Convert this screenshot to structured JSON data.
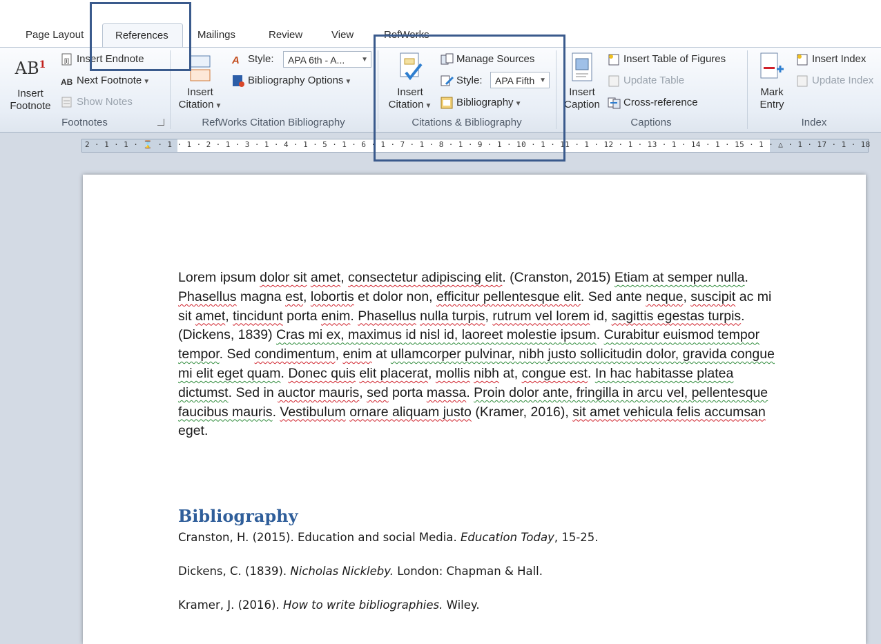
{
  "tabs": {
    "page_layout": "Page Layout",
    "references": "References",
    "mailings": "Mailings",
    "review": "Review",
    "view": "View",
    "refworks": "RefWorks"
  },
  "footnotes": {
    "ab_glyph": "AB",
    "ab_sup": "1",
    "insert_footnote_l1": "Insert",
    "insert_footnote_l2": "Footnote",
    "insert_endnote": "Insert Endnote",
    "next_footnote": "Next Footnote",
    "show_notes": "Show Notes",
    "group_label": "Footnotes"
  },
  "refworks": {
    "insert_citation_l1": "Insert",
    "insert_citation_l2": "Citation",
    "style_label": "Style:",
    "style_value": "APA 6th - A...",
    "bibliography_options": "Bibliography Options",
    "group_label": "RefWorks Citation  Bibliography"
  },
  "citations": {
    "insert_citation_l1": "Insert",
    "insert_citation_l2": "Citation",
    "manage_sources": "Manage Sources",
    "style_label": "Style:",
    "style_value": "APA Fifth",
    "bibliography": "Bibliography",
    "group_label": "Citations & Bibliography"
  },
  "captions": {
    "insert_caption_l1": "Insert",
    "insert_caption_l2": "Caption",
    "insert_table_of_figures": "Insert Table of Figures",
    "update_table": "Update Table",
    "cross_reference": "Cross-reference",
    "group_label": "Captions"
  },
  "index": {
    "mark_entry_l1": "Mark",
    "mark_entry_l2": "Entry",
    "insert_index": "Insert Index",
    "update_index": "Update Index",
    "group_label": "Index"
  },
  "ruler": {
    "scale": "2 · 1 · 1 · ⌛ · 1 · 1 · 2 · 1 · 3 · 1 · 4 · 1 · 5 · 1 · 6 · 1 · 7 · 1 · 8 · 1 · 9 · 1 · 10 · 1 · 11 · 1 · 12 · 1 · 13 · 1 · 14 · 1 · 15 · 1 · △ · 1 · 17 · 1 · 18"
  },
  "document": {
    "paragraph": [
      {
        "t": "Lorem ipsum ",
        "s": ""
      },
      {
        "t": "dolor sit",
        "s": "sp"
      },
      {
        "t": " ",
        "s": ""
      },
      {
        "t": "amet",
        "s": "sp"
      },
      {
        "t": ", ",
        "s": ""
      },
      {
        "t": "consectetur adipiscing elit",
        "s": "sp"
      },
      {
        "t": ". (Cranston, 2015) ",
        "s": ""
      },
      {
        "t": "Etiam at semper nulla",
        "s": "gr"
      },
      {
        "t": ". ",
        "s": ""
      },
      {
        "t": "Phasellus",
        "s": "sp"
      },
      {
        "t": " magna ",
        "s": ""
      },
      {
        "t": "est",
        "s": "sp"
      },
      {
        "t": ", ",
        "s": ""
      },
      {
        "t": "lobortis",
        "s": "sp"
      },
      {
        "t": " et dolor non, ",
        "s": ""
      },
      {
        "t": "efficitur pellentesque elit",
        "s": "sp"
      },
      {
        "t": ". Sed ante ",
        "s": ""
      },
      {
        "t": "neque",
        "s": "sp"
      },
      {
        "t": ", ",
        "s": ""
      },
      {
        "t": "suscipit",
        "s": "sp"
      },
      {
        "t": " ac mi sit ",
        "s": ""
      },
      {
        "t": "amet",
        "s": "sp"
      },
      {
        "t": ", ",
        "s": ""
      },
      {
        "t": "tincidunt",
        "s": "sp"
      },
      {
        "t": " porta ",
        "s": ""
      },
      {
        "t": "enim",
        "s": "sp"
      },
      {
        "t": ". ",
        "s": ""
      },
      {
        "t": "Phasellus",
        "s": "sp"
      },
      {
        "t": " ",
        "s": ""
      },
      {
        "t": "nulla turpis",
        "s": "sp"
      },
      {
        "t": ", ",
        "s": ""
      },
      {
        "t": "rutrum vel lorem",
        "s": "sp"
      },
      {
        "t": " id, ",
        "s": ""
      },
      {
        "t": "sagittis egestas turpis",
        "s": "sp"
      },
      {
        "t": ". (Dickens, 1839) ",
        "s": ""
      },
      {
        "t": "Cras mi ex, maximus id nisl id, laoreet molestie ipsum",
        "s": "gr"
      },
      {
        "t": ". ",
        "s": ""
      },
      {
        "t": "Curabitur euismod tempor tempor",
        "s": "gr"
      },
      {
        "t": ". Sed ",
        "s": ""
      },
      {
        "t": "condimentum",
        "s": "sp"
      },
      {
        "t": ", ",
        "s": ""
      },
      {
        "t": "enim",
        "s": "sp"
      },
      {
        "t": " at ",
        "s": ""
      },
      {
        "t": "ullamcorper pulvinar, nibh justo sollicitudin dolor, gravida congue mi elit eget quam",
        "s": "gr"
      },
      {
        "t": ". ",
        "s": ""
      },
      {
        "t": "Donec quis",
        "s": "sp"
      },
      {
        "t": " ",
        "s": ""
      },
      {
        "t": "elit placerat",
        "s": "sp"
      },
      {
        "t": ", ",
        "s": ""
      },
      {
        "t": "mollis",
        "s": "sp"
      },
      {
        "t": " ",
        "s": ""
      },
      {
        "t": "nibh",
        "s": "sp"
      },
      {
        "t": " at, ",
        "s": ""
      },
      {
        "t": "congue est",
        "s": "sp"
      },
      {
        "t": ". ",
        "s": ""
      },
      {
        "t": "In hac habitasse platea dictumst",
        "s": "gr"
      },
      {
        "t": ". Sed in ",
        "s": ""
      },
      {
        "t": "auctor mauris",
        "s": "sp"
      },
      {
        "t": ", ",
        "s": ""
      },
      {
        "t": "sed",
        "s": "sp"
      },
      {
        "t": " porta ",
        "s": ""
      },
      {
        "t": "massa",
        "s": "sp"
      },
      {
        "t": ". ",
        "s": ""
      },
      {
        "t": "Proin dolor ante, fringilla in arcu vel, pellentesque faucibus mauris",
        "s": "gr"
      },
      {
        "t": ". ",
        "s": ""
      },
      {
        "t": "Vestibulum",
        "s": "sp"
      },
      {
        "t": " ",
        "s": ""
      },
      {
        "t": "ornare aliquam justo",
        "s": "sp"
      },
      {
        "t": " (Kramer, 2016), ",
        "s": ""
      },
      {
        "t": "sit amet vehicula felis accumsan",
        "s": "sp"
      },
      {
        "t": " eget.",
        "s": ""
      }
    ],
    "bibliography_heading": "Bibliography",
    "entries": [
      {
        "pre": "Cranston, H. (2015). Education and social Media. ",
        "it": "Education Today",
        "post": ", 15-25."
      },
      {
        "pre": "Dickens, C. (1839). ",
        "it": "Nicholas Nickleby.",
        "post": " London: Chapman & Hall."
      },
      {
        "pre": "Kramer, J. (2016). ",
        "it": "How to write bibliographies.",
        "post": " Wiley."
      }
    ]
  },
  "colors": {
    "highlight_box": "#3a5a8c",
    "heading": "#2f5e9a",
    "spell_underline": "#d0202a",
    "grammar_underline": "#2e8b3a"
  }
}
